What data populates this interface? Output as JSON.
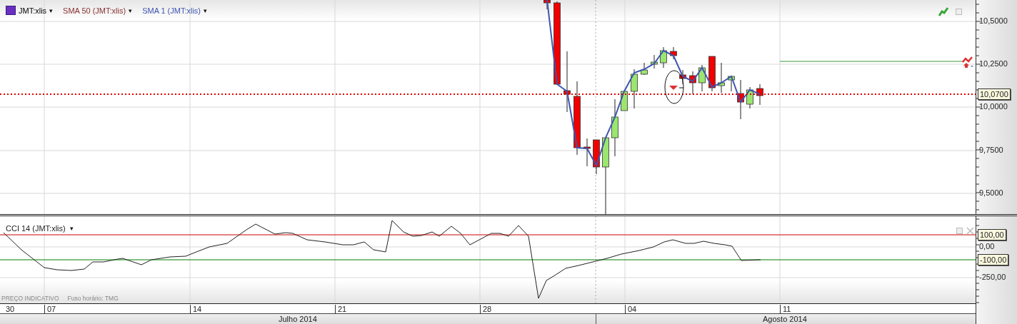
{
  "legend": [
    {
      "label": "JMT:xlis",
      "menu": "▾",
      "kind": "symbol"
    },
    {
      "label": "SMA 50 (JMT:xlis)",
      "menu": "▾",
      "kind": "slow"
    },
    {
      "label": "SMA 1 (JMT:xlis)",
      "menu": "▾",
      "kind": "fast"
    }
  ],
  "price_axis": {
    "ticks": [
      "10,5000",
      "10,2500",
      "10,0000",
      "9,7500",
      "9,5000"
    ],
    "current_price": "10,0700"
  },
  "indicator": {
    "label": "CCI 14 (JMT:xlis)",
    "menu": "▾",
    "ticks": [
      "0,00",
      "-250,00"
    ],
    "levels": [
      "100,00",
      "-100,00"
    ]
  },
  "footer_note": [
    "PREÇO INDICATIVO",
    "Fuso horário: TMG"
  ],
  "date_axis": {
    "days": [
      "30",
      "07",
      "14",
      "21",
      "28",
      "04",
      "11"
    ],
    "months": [
      "Julho 2014",
      "Agosto 2014"
    ]
  }
}
